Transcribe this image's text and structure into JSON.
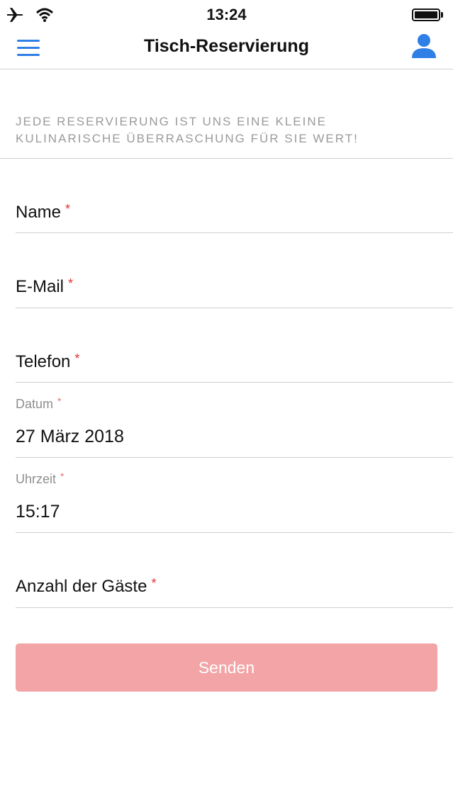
{
  "status_bar": {
    "time": "13:24",
    "icons": [
      "airplane-icon",
      "wifi-icon",
      "battery-icon"
    ]
  },
  "nav": {
    "title": "Tisch-Reservierung",
    "menu_icon": "hamburger-menu-icon",
    "user_icon": "user-icon",
    "accent_color": "#2f7fe6"
  },
  "intro": {
    "text_line1": "Jede Reservierung ist uns eine kleine",
    "text_line2": "kulinarische Überraschung für Sie wert!"
  },
  "form": {
    "required_marker": "*",
    "name": {
      "label": "Name",
      "value": ""
    },
    "email": {
      "label": "E-Mail",
      "value": ""
    },
    "phone": {
      "label": "Telefon",
      "value": ""
    },
    "date": {
      "label": "Datum",
      "value": "27 März 2018"
    },
    "time": {
      "label": "Uhrzeit",
      "value": "15:17"
    },
    "guests": {
      "label": "Anzahl der Gäste",
      "value": ""
    },
    "submit_label": "Senden",
    "submit_color": "#f2a4a6",
    "required_color": "#e03232"
  }
}
